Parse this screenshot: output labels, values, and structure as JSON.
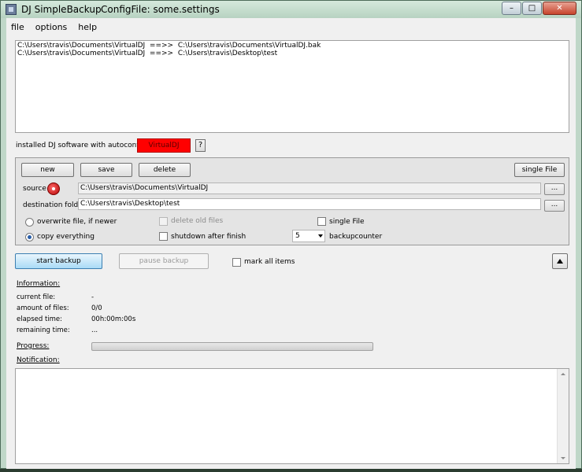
{
  "window": {
    "title": "DJ SimpleBackup",
    "config_file": "ConfigFile: some.settings",
    "caption_min": "–",
    "caption_max": "□",
    "caption_close": "✕"
  },
  "menu": [
    "file",
    "options",
    "help"
  ],
  "jobs": [
    "C:\\Users\\travis\\Documents\\VirtualDJ  ==>>  C:\\Users\\travis\\Documents\\VirtualDJ.bak",
    "C:\\Users\\travis\\Documents\\VirtualDJ  ==>>  C:\\Users\\travis\\Desktop\\test"
  ],
  "autoconfig": {
    "label": "installed DJ software with autoconfig:",
    "software_button": "VirtualDJ",
    "help_button": "?",
    "software_color": "#ff0000"
  },
  "job_editor": {
    "new_button": "new",
    "save_button": "save",
    "delete_button": "delete",
    "single_file_button": "single File",
    "source_label": "source",
    "source_value": "C:\\Users\\travis\\Documents\\VirtualDJ",
    "source_browse": "...",
    "dest_label": "destination folder",
    "dest_value": "C:\\Users\\travis\\Desktop\\test",
    "dest_browse": "...",
    "overwrite_label": "overwrite file, if newer",
    "overwrite_selected": false,
    "copy_label": "copy everything",
    "copy_selected": true,
    "delete_old_label": "delete old files",
    "delete_old_enabled": false,
    "shutdown_label": "shutdown after finish",
    "shutdown_checked": false,
    "single_file_label": "single File",
    "single_file_checked": false,
    "backupcounter_value": "5",
    "backupcounter_label": "backupcounter"
  },
  "actions": {
    "start_button": "start backup",
    "pause_button": "pause backup",
    "mark_all_label": "mark all items",
    "collapse_icon": "triangle-up-icon"
  },
  "info": {
    "heading": "Information:",
    "current_file_label": "current file:",
    "current_file_value": "-",
    "amount_label": "amount of files:",
    "amount_value": "0/0",
    "elapsed_label": "elapsed time:",
    "elapsed_value": "00h:00m:00s",
    "remaining_label": "remaining time:",
    "remaining_value": "..."
  },
  "progress": {
    "heading": "Progress:",
    "fraction": 0
  },
  "notification": {
    "heading": "Notification:"
  }
}
